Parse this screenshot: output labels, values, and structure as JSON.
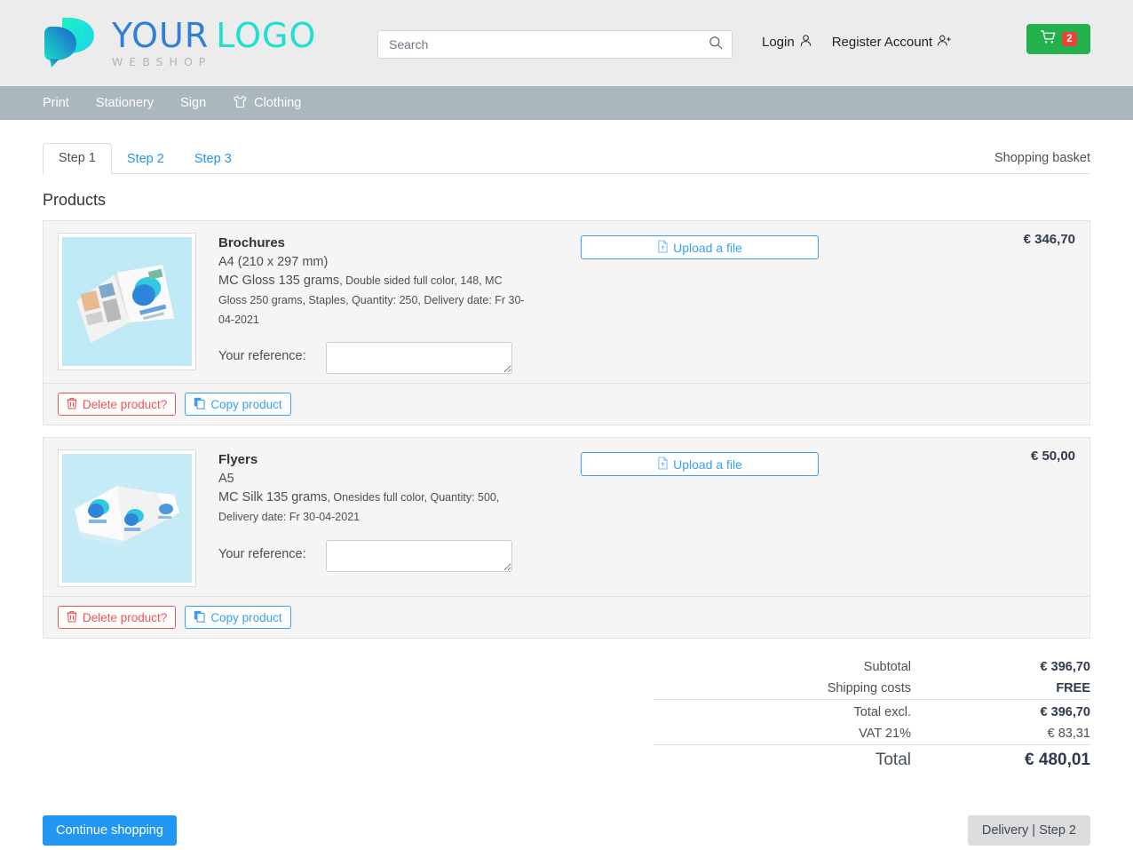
{
  "header": {
    "logo": {
      "top_left": "YOUR",
      "top_right": "LOGO",
      "subtitle": "WEBSHOP"
    },
    "search": {
      "value": "",
      "placeholder": "Search"
    },
    "login_label": "Login",
    "register_label": "Register Account",
    "cart_count": "2",
    "cart_color": "#22b14c",
    "badge_color": "#ef4136"
  },
  "nav": {
    "items": [
      {
        "label": "Print",
        "icon": ""
      },
      {
        "label": "Stationery",
        "icon": ""
      },
      {
        "label": "Sign",
        "icon": ""
      },
      {
        "label": "Clothing",
        "icon": "tshirt-icon"
      }
    ]
  },
  "tabs": {
    "items": [
      {
        "label": "Step 1",
        "active": true
      },
      {
        "label": "Step 2",
        "active": false
      },
      {
        "label": "Step 3",
        "active": false
      }
    ],
    "basket_label": "Shopping basket"
  },
  "page": {
    "section_title": "Products"
  },
  "products": [
    {
      "name": "Brochures",
      "size": "A4 (210 x 297 mm)",
      "spec_main": "MC Gloss 135 grams",
      "spec_rest": ", Double sided full color, 148, MC Gloss 250 grams, Staples, Quantity: 250, Delivery date: Fr 30-04-2021",
      "reference_label": "Your reference:",
      "reference_value": "",
      "upload_label": "Upload a file",
      "price": "€ 346,70",
      "delete_label": "Delete product?",
      "copy_label": "Copy product",
      "thumb": "brochure-mockup"
    },
    {
      "name": "Flyers",
      "size": "A5",
      "spec_main": "MC Silk 135 grams",
      "spec_rest": ", Onesides full color, Quantity: 500, Delivery date: Fr 30-04-2021",
      "reference_label": "Your reference:",
      "reference_value": "",
      "upload_label": "Upload a file",
      "price": "€ 50,00",
      "delete_label": "Delete product?",
      "copy_label": "Copy product",
      "thumb": "flyer-mockup"
    }
  ],
  "totals": {
    "subtotal_label": "Subtotal",
    "subtotal_value": "€ 396,70",
    "shipping_label": "Shipping costs",
    "shipping_value": "FREE",
    "total_excl_label": "Total excl.",
    "total_excl_value": "€ 396,70",
    "vat_label": "VAT 21%",
    "vat_value": "€ 83,31",
    "total_label": "Total",
    "total_value": "€ 480,01",
    "free_color": "#5cb85c"
  },
  "footer": {
    "continue_label": "Continue shopping",
    "next_label": "Delivery | Step 2",
    "primary_color": "#2196f3"
  }
}
